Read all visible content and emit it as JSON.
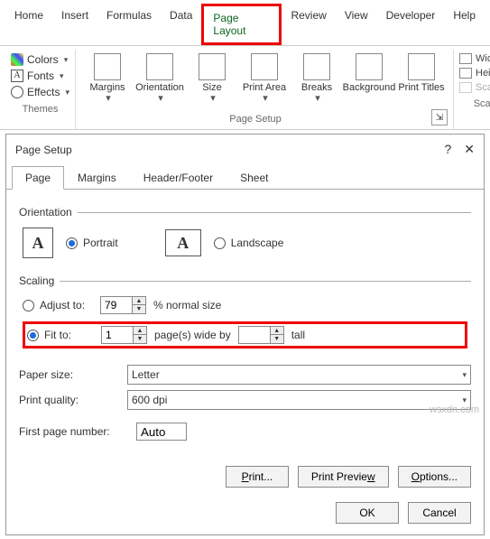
{
  "ribbon_tabs": [
    "Home",
    "Insert",
    "Formulas",
    "Data",
    "Page Layout",
    "Review",
    "View",
    "Developer",
    "Help"
  ],
  "themes": {
    "colors": "Colors",
    "fonts": "Fonts",
    "effects": "Effects",
    "group": "Themes"
  },
  "page_setup": {
    "items": [
      "Margins",
      "Orientation",
      "Size",
      "Print Area",
      "Breaks",
      "Background",
      "Print Titles"
    ],
    "group": "Page Setup"
  },
  "scale": {
    "width": "Width:",
    "height": "Height:",
    "scale_lbl": "Scale:",
    "group": "Scal"
  },
  "dialog": {
    "title": "Page Setup",
    "tabs": [
      "Page",
      "Margins",
      "Header/Footer",
      "Sheet"
    ],
    "orientation": {
      "legend": "Orientation",
      "portrait": "Portrait",
      "landscape": "Landscape"
    },
    "scaling": {
      "legend": "Scaling",
      "adjust": "Adjust to:",
      "adjust_val": "79",
      "adjust_suffix": "% normal size",
      "fit": "Fit to:",
      "fit_w": "1",
      "fit_mid": "page(s) wide by",
      "fit_h": "",
      "fit_suffix": "tall"
    },
    "paper_size_lbl": "Paper size:",
    "paper_size": "Letter",
    "print_quality_lbl": "Print quality:",
    "print_quality": "600 dpi",
    "first_page_lbl": "First page number:",
    "first_page": "Auto",
    "buttons": {
      "print": "Print...",
      "preview": "Print Preview",
      "options": "Options...",
      "ok": "OK",
      "cancel": "Cancel"
    }
  },
  "watermark": "wsxdn.com"
}
